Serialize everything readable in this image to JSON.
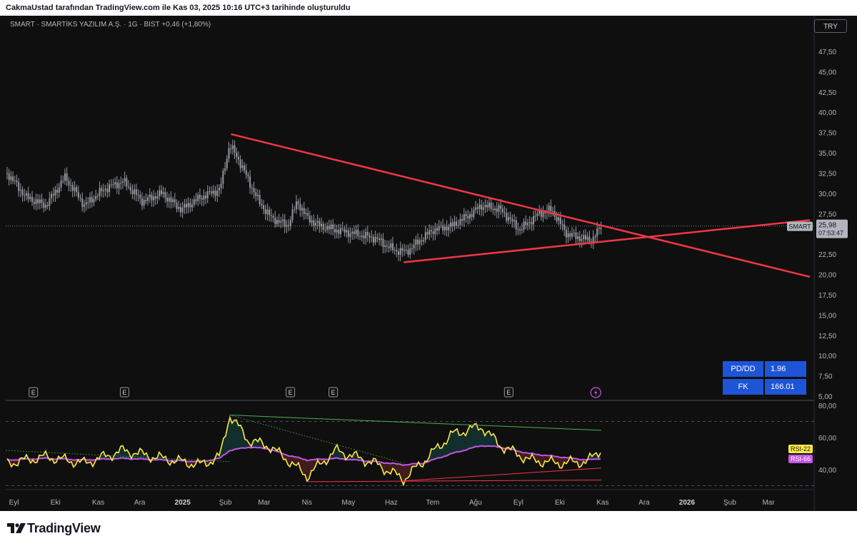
{
  "header": {
    "title": "CakmaUstad tarafından TradingView.com ile Kas 03, 2025 10:16 UTC+3 tarihinde oluşturuldu"
  },
  "legend": {
    "symbol_line": "SMART · SMARTİKS YAZILIM A.Ş. · 1G · BIST",
    "change": "+0,46 (+1,80%)"
  },
  "currency_button": "TRY",
  "price_axis": {
    "ticks": [
      "47,50",
      "45,00",
      "42,50",
      "40,00",
      "37,50",
      "35,00",
      "32,50",
      "30,00",
      "27,50",
      "25,00",
      "22,50",
      "20,00",
      "17,50",
      "15,00",
      "12,50",
      "10,00",
      "7,50",
      "5,00"
    ],
    "tick_values": [
      47.5,
      45,
      42.5,
      40,
      37.5,
      35,
      32.5,
      30,
      27.5,
      25,
      22.5,
      20,
      17.5,
      15,
      12.5,
      10,
      7.5,
      5
    ]
  },
  "last_price": {
    "symbol": "SMART",
    "price": "25,98",
    "countdown": "07:53:47",
    "value": 25.98
  },
  "fundamentals": [
    {
      "label": "PD/DD",
      "value": "1.96"
    },
    {
      "label": "FK",
      "value": "166.01"
    }
  ],
  "rsi_axis": {
    "ticks": [
      "80,00",
      "60,00",
      "40,00"
    ],
    "tick_values": [
      80,
      60,
      40
    ]
  },
  "rsi_labels": {
    "fast": "RSI-22",
    "slow": "RSI-66"
  },
  "time_axis": [
    "Eyl",
    "Eki",
    "Kas",
    "Ara",
    "2025",
    "Şub",
    "Mar",
    "Nis",
    "May",
    "Haz",
    "Tem",
    "Ağu",
    "Eyl",
    "Eki",
    "Kas",
    "Ara",
    "2026",
    "Şub",
    "Mar"
  ],
  "event_markers": {
    "earnings_label": "E",
    "count": 5
  },
  "brand": {
    "name": "TradingView"
  },
  "colors": {
    "background": "#0f0f0f",
    "candle": "#9598a1",
    "trendline": "#f23645",
    "rsi_fast": "#fbe944",
    "rsi_slow": "#c355e6",
    "upper_rsi_line": "#4caf50",
    "fund_bg": "#1e54d6"
  },
  "chart_data": [
    {
      "type": "candlestick",
      "title": "SMART · SMARTİKS YAZILIM A.Ş. · 1G · BIST",
      "x": [
        "2024-08-27",
        "2024-09-10",
        "2024-09-24",
        "2024-10-08",
        "2024-10-22",
        "2024-11-05",
        "2024-11-19",
        "2024-12-03",
        "2024-12-17",
        "2024-12-31",
        "2025-01-14",
        "2025-01-28",
        "2025-02-04",
        "2025-02-11",
        "2025-02-25",
        "2025-03-06",
        "2025-03-18",
        "2025-03-25",
        "2025-04-01",
        "2025-04-10",
        "2025-04-22",
        "2025-05-06",
        "2025-05-20",
        "2025-06-03",
        "2025-06-12",
        "2025-06-17",
        "2025-07-01",
        "2025-07-15",
        "2025-07-29",
        "2025-08-05",
        "2025-08-19",
        "2025-09-02",
        "2025-09-16",
        "2025-09-25",
        "2025-10-06",
        "2025-10-16",
        "2025-10-24",
        "2025-10-31"
      ],
      "close": [
        32.5,
        29.5,
        28.5,
        32.0,
        28.5,
        30.5,
        31.5,
        29.0,
        30.0,
        28.0,
        29.5,
        30.5,
        36.0,
        34.0,
        29.0,
        27.0,
        26.0,
        29.0,
        27.0,
        26.0,
        25.5,
        25.0,
        24.5,
        23.0,
        22.8,
        23.5,
        25.5,
        26.0,
        27.5,
        28.5,
        28.0,
        25.5,
        27.5,
        28.0,
        25.0,
        24.5,
        24.2,
        25.98
      ],
      "ylim": [
        5.0,
        49.0
      ],
      "trendlines": [
        {
          "name": "descending",
          "points": [
            [
              "2025-02-05",
              37.3
            ],
            [
              "2026-03-31",
              19.7
            ]
          ]
        },
        {
          "name": "ascending",
          "points": [
            [
              "2025-06-10",
              21.5
            ],
            [
              "2026-03-31",
              26.7
            ]
          ]
        }
      ]
    },
    {
      "type": "line",
      "title": "RSI",
      "x": [
        "2024-08-27",
        "2024-09-24",
        "2024-10-22",
        "2024-11-19",
        "2024-12-17",
        "2025-01-14",
        "2025-01-28",
        "2025-02-04",
        "2025-02-18",
        "2025-03-04",
        "2025-03-18",
        "2025-04-01",
        "2025-04-22",
        "2025-05-20",
        "2025-06-10",
        "2025-06-24",
        "2025-07-15",
        "2025-08-05",
        "2025-08-19",
        "2025-09-09",
        "2025-09-30",
        "2025-10-21",
        "2025-10-31"
      ],
      "series": [
        {
          "name": "RSI-22",
          "values": [
            44,
            48,
            44,
            52,
            47,
            43,
            48,
            74,
            58,
            55,
            46,
            36,
            52,
            44,
            34,
            45,
            62,
            67,
            55,
            46,
            44,
            45,
            53
          ]
        },
        {
          "name": "RSI-66",
          "values": [
            46,
            47,
            46,
            47,
            46,
            45,
            47,
            52,
            54,
            53,
            49,
            46,
            47,
            45,
            43,
            44,
            50,
            55,
            54,
            50,
            48,
            46,
            47
          ]
        }
      ],
      "ylim": [
        30,
        80
      ]
    }
  ]
}
